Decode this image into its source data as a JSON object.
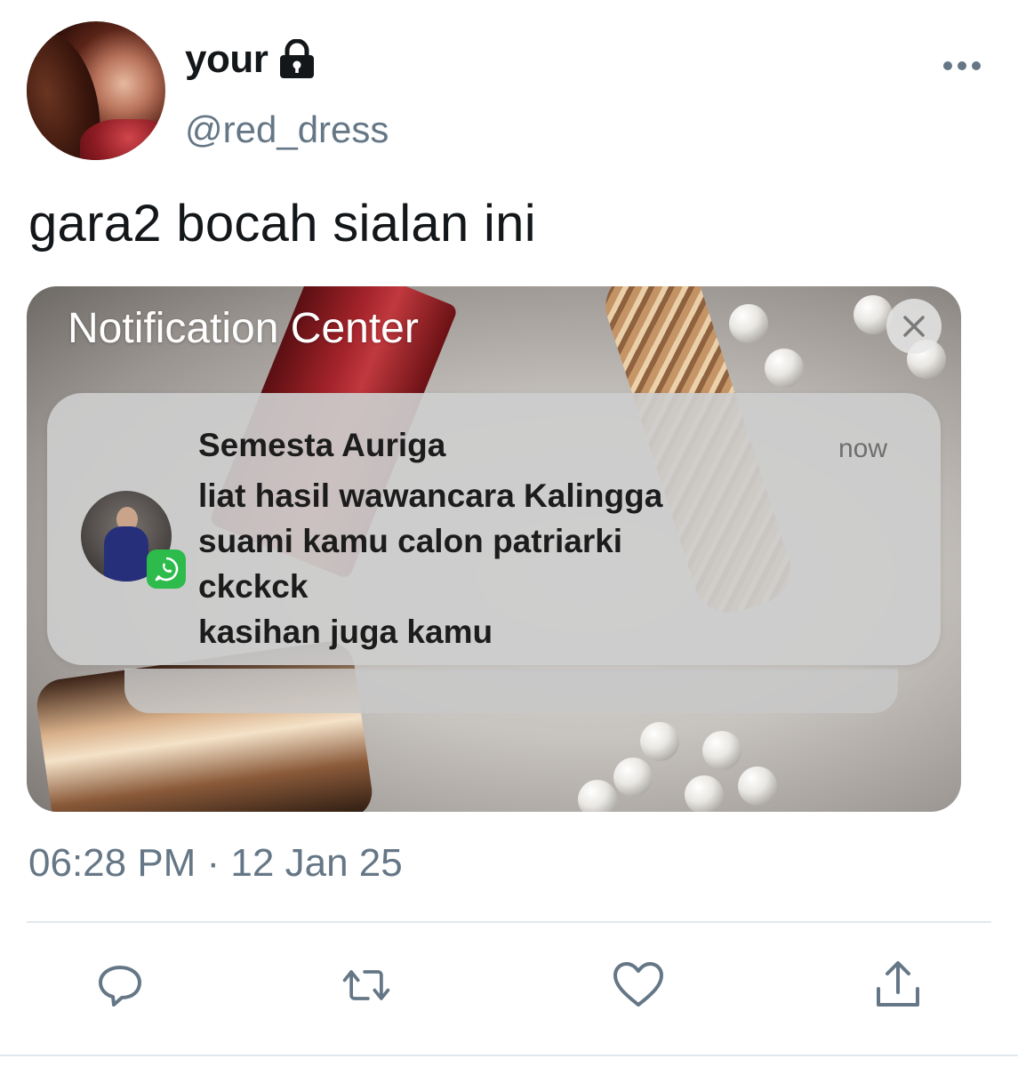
{
  "tweet": {
    "display_name": "your",
    "handle": "@red_dress",
    "text": "gara2 bocah sialan ini",
    "timestamp": "06:28 PM · 12 Jan 25",
    "icons": {
      "lock": "lock-icon",
      "more": "more-icon",
      "reply": "reply-icon",
      "retweet": "retweet-icon",
      "like": "heart-icon",
      "share": "share-icon"
    }
  },
  "notification_center": {
    "title": "Notification Center",
    "notification": {
      "sender": "Semesta Auriga",
      "time": "now",
      "lines": [
        "liat hasil wawancara Kalingga",
        "suami kamu calon patriarki",
        "ckckck",
        "kasihan juga kamu"
      ],
      "app_badge": "whatsapp-icon"
    }
  },
  "colors": {
    "secondary_text": "#657786",
    "primary_text": "#14171a",
    "whatsapp_green": "#2dbb4b",
    "divider": "#e1e8ed"
  }
}
